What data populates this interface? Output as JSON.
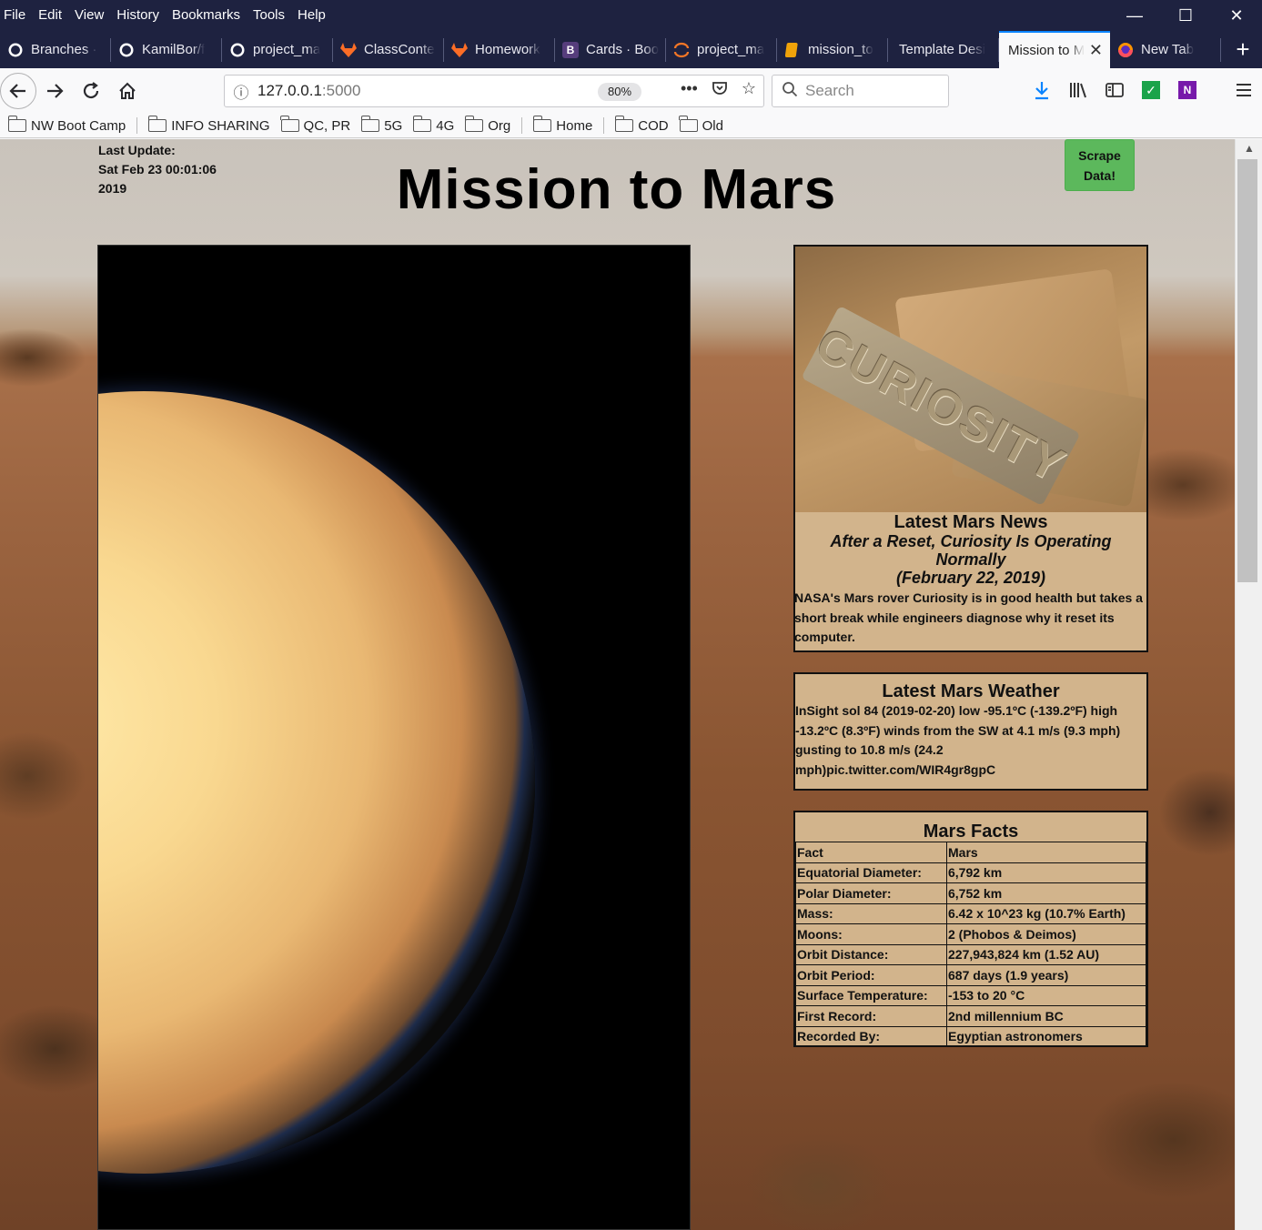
{
  "menubar": {
    "items": [
      "File",
      "Edit",
      "View",
      "History",
      "Bookmarks",
      "Tools",
      "Help"
    ],
    "window_controls": [
      "minimize-icon",
      "maximize-icon",
      "close-icon"
    ]
  },
  "tabs": [
    {
      "title": "Branches ·",
      "icon": "github-icon"
    },
    {
      "title": "KamilBor/f",
      "icon": "github-icon"
    },
    {
      "title": "project_ma",
      "icon": "github-icon"
    },
    {
      "title": "ClassConte",
      "icon": "gitlab-icon"
    },
    {
      "title": "Homework",
      "icon": "gitlab-icon"
    },
    {
      "title": "Cards · Boo",
      "icon": "bootstrap-icon"
    },
    {
      "title": "project_ma",
      "icon": "jupyter-icon"
    },
    {
      "title": "mission_to",
      "icon": "notebook-icon"
    },
    {
      "title": "Template Desi",
      "icon": "none"
    },
    {
      "title": "Mission to M",
      "icon": "none",
      "active": true
    },
    {
      "title": "New Tab",
      "icon": "firefox-icon"
    }
  ],
  "navbar": {
    "url_host": "127.0.0.1",
    "url_port": ":5000",
    "zoom": "80%",
    "search_placeholder": "Search"
  },
  "bookmarks": [
    "NW Boot Camp",
    "INFO SHARING",
    "QC, PR",
    "5G",
    "4G",
    "Org",
    "Home",
    "COD",
    "Old"
  ],
  "page": {
    "last_update_label": "Last Update:",
    "last_update_value": "Sat Feb 23 00:01:06 2019",
    "title": "Mission to Mars",
    "scrape_button": "Scrape Data!",
    "news": {
      "heading": "Latest Mars News",
      "title": "After a Reset, Curiosity Is Operating Normally",
      "date": "(February 22, 2019)",
      "body": "NASA's Mars rover Curiosity is in good health but takes a short break while engineers diagnose why it reset its computer.",
      "image_text": "CURIOSITY"
    },
    "weather": {
      "heading": "Latest Mars Weather",
      "body": "InSight sol 84 (2019-02-20) low -95.1ºC (-139.2ºF) high -13.2ºC (8.3ºF) winds from the SW at 4.1 m/s (9.3 mph) gusting to 10.8 m/s (24.2 mph)pic.twitter.com/WIR4gr8gpC"
    },
    "facts": {
      "heading": "Mars Facts",
      "rows": [
        [
          "Fact",
          "Mars"
        ],
        [
          "Equatorial Diameter:",
          "6,792 km"
        ],
        [
          "Polar Diameter:",
          "6,752 km"
        ],
        [
          "Mass:",
          "6.42 x 10^23 kg (10.7% Earth)"
        ],
        [
          "Moons:",
          "2 (Phobos & Deimos)"
        ],
        [
          "Orbit Distance:",
          "227,943,824 km (1.52 AU)"
        ],
        [
          "Orbit Period:",
          "687 days (1.9 years)"
        ],
        [
          "Surface Temperature:",
          "-153 to 20 °C"
        ],
        [
          "First Record:",
          "2nd millennium BC"
        ],
        [
          "Recorded By:",
          "Egyptian astronomers"
        ]
      ]
    }
  }
}
